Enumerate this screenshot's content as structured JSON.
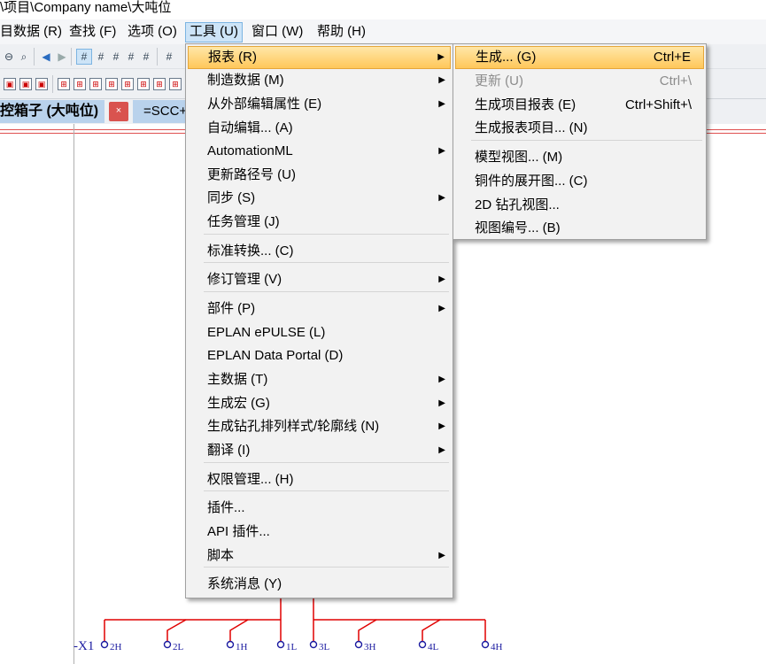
{
  "window": {
    "title": "\\项目\\Company name\\大吨位"
  },
  "menubar": {
    "items": [
      {
        "label": "目数据 (R)"
      },
      {
        "label": "查找 (F)"
      },
      {
        "label": "选项 (O)"
      },
      {
        "label": "工具 (U)"
      },
      {
        "label": "窗口 (W)"
      },
      {
        "label": "帮助 (H)"
      }
    ]
  },
  "tabs": {
    "active_label": "控箱子 (大吨位)",
    "close_glyph": "×",
    "second_label": "=SCC+"
  },
  "tools_menu": {
    "items": [
      {
        "label": "报表 (R)",
        "arrow": "▶"
      },
      {
        "label": "制造数据 (M)",
        "arrow": "▶"
      },
      {
        "label": "从外部编辑属性 (E)",
        "arrow": "▶"
      },
      {
        "label": "自动编辑... (A)"
      },
      {
        "label": "AutomationML",
        "arrow": "▶"
      },
      {
        "label": "更新路径号 (U)"
      },
      {
        "label": "同步 (S)",
        "arrow": "▶"
      },
      {
        "label": "任务管理 (J)"
      },
      {
        "label": "标准转换... (C)"
      },
      {
        "label": "修订管理 (V)",
        "arrow": "▶"
      },
      {
        "label": "部件 (P)",
        "arrow": "▶"
      },
      {
        "label": "EPLAN ePULSE (L)"
      },
      {
        "label": "EPLAN Data Portal (D)"
      },
      {
        "label": "主数据 (T)",
        "arrow": "▶"
      },
      {
        "label": "生成宏 (G)",
        "arrow": "▶"
      },
      {
        "label": "生成钻孔排列样式/轮廓线 (N)",
        "arrow": "▶"
      },
      {
        "label": "翻译 (I)",
        "arrow": "▶"
      },
      {
        "label": "权限管理... (H)"
      },
      {
        "label": "插件..."
      },
      {
        "label": "API 插件..."
      },
      {
        "label": "脚本",
        "arrow": "▶"
      },
      {
        "label": "系统消息 (Y)"
      }
    ]
  },
  "report_submenu": {
    "items": [
      {
        "label": "生成... (G)",
        "shortcut": "Ctrl+E"
      },
      {
        "label": "更新 (U)",
        "shortcut": "Ctrl+\\"
      },
      {
        "label": "生成项目报表 (E)",
        "shortcut": "Ctrl+Shift+\\"
      },
      {
        "label": "生成报表项目... (N)"
      },
      {
        "label": "模型视图... (M)"
      },
      {
        "label": "铜件的展开图... (C)"
      },
      {
        "label": "2D 钻孔视图..."
      },
      {
        "label": "视图编号... (B)"
      }
    ]
  },
  "schematic": {
    "device_tag": "-X1",
    "terminals": [
      "2H",
      "2L",
      "1H",
      "1L",
      "3L",
      "3H",
      "4L",
      "4H"
    ]
  },
  "colors": {
    "highlight": "#ffd37a",
    "wire": "#e00000",
    "terminal": "#1a1aa0"
  }
}
